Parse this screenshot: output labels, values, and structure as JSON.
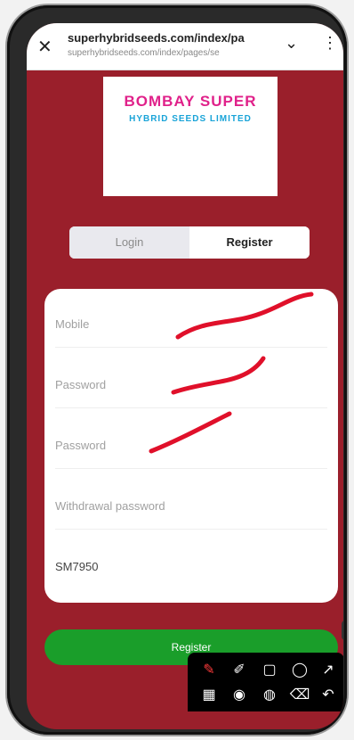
{
  "browser": {
    "url_title": "superhybridseeds.com/index/pa",
    "url_full": "superhybridseeds.com/index/pages/se"
  },
  "logo": {
    "line1": "BOMBAY SUPER",
    "line2": "HYBRID SEEDS LIMITED"
  },
  "tabs": {
    "login": "Login",
    "register": "Register"
  },
  "form": {
    "mobile_placeholder": "Mobile",
    "password_placeholder": "Password",
    "confirm_password_placeholder": "Password",
    "withdrawal_password_placeholder": "Withdrawal password",
    "invite_code_value": "SM7950"
  },
  "register_button": "Register",
  "colors": {
    "page_background": "#9a1f2b",
    "register_button": "#1a9e2a",
    "scribble": "#e0102a"
  },
  "toolbar": {
    "tools": [
      "pen-icon",
      "highlighter-icon",
      "rectangle-icon",
      "circle-icon",
      "arrow-icon",
      "mosaic-icon",
      "camera-icon",
      "color-picker-icon",
      "eraser-icon",
      "undo-icon"
    ]
  }
}
